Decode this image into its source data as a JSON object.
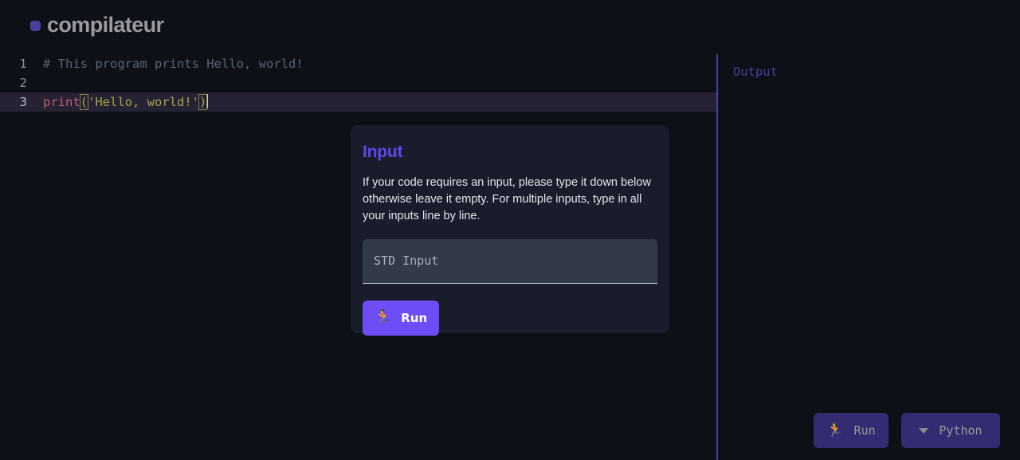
{
  "app": {
    "brand": "compilateur",
    "logo_mark_color": "#4b3fa0",
    "background": "#0d1016",
    "accent": "#6c4df6"
  },
  "editor": {
    "language": "Python",
    "active_line": 3,
    "lines": [
      {
        "number": "1",
        "text": "# This program prints Hello, world!"
      },
      {
        "number": "2",
        "text": ""
      },
      {
        "number": "3",
        "text": "print('Hello, world!')"
      }
    ],
    "line_numbers": {
      "one": "1",
      "two": "2",
      "three": "3"
    },
    "tokens": {
      "comment": "# This program prints Hello, world!",
      "fn": "print",
      "open_paren": "(",
      "string": "'Hello, world!'",
      "close_paren": ")"
    }
  },
  "output": {
    "label": "Output",
    "content": "",
    "divider_color": "#4a3fae",
    "actions": {
      "run_label": "Run",
      "run_icon": "running-person-icon",
      "language_label": "Python",
      "language_icon": "chevron-down-icon"
    }
  },
  "modal": {
    "title": "Input",
    "title_color": "#5b48f0",
    "description": "If your code requires an input, please type it down below otherwise leave it empty. For multiple inputs, type in all your inputs line by line.",
    "std_input": {
      "placeholder": "STD Input",
      "value": ""
    },
    "run_button": {
      "label": "Run",
      "icon": "running-person-icon"
    }
  }
}
